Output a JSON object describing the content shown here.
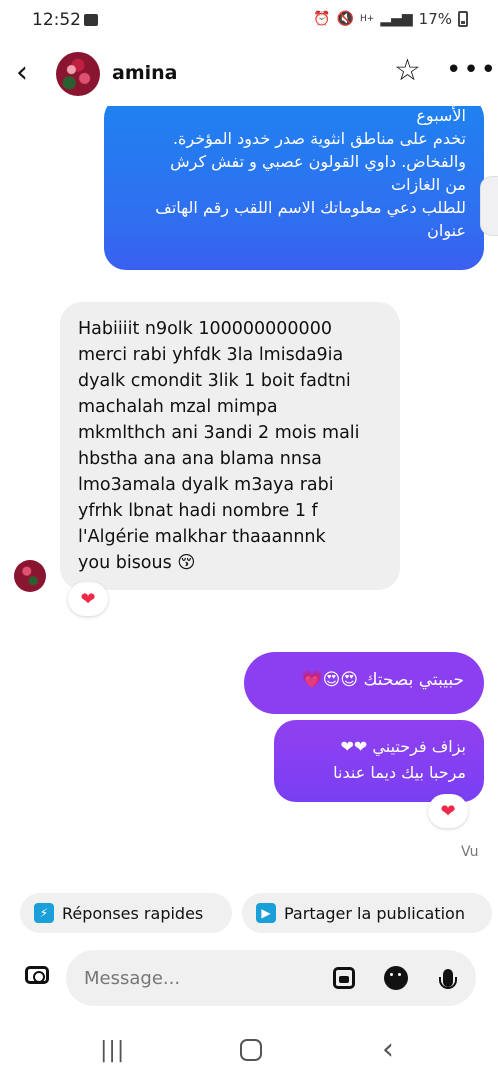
{
  "status_bar": {
    "time": "12:52",
    "icons": [
      "gallery-icon",
      "alarm-icon",
      "mute-icon",
      "network-icon",
      "signal-icon"
    ],
    "battery": "17%"
  },
  "header": {
    "contact_name": "amina",
    "icons": [
      "back-icon",
      "avatar",
      "star-icon",
      "more-icon"
    ]
  },
  "messages": {
    "sent_blue": {
      "lines": [
        "الأسبوع",
        "تخدم على مناطق انثوية صدر خدود  المؤخرة.",
        "والفخاض. داوي القولون عصبي و تفش كرش",
        "من الغازات",
        "للطلب دعي معلوماتك الاسم اللقب رقم  الهاتف",
        "عنوان"
      ]
    },
    "received": {
      "lines": [
        "Habiiiit n9olk 100000000000",
        "merci rabi yhfdk 3la lmisda9ia",
        "dyalk cmondit 3lik 1 boit fadtni",
        "machalah mzal mimpa",
        "mkmlthch ani 3andi 2 mois mali",
        "hbstha ana ana blama nnsa",
        "lmo3amala dyalk m3aya rabi",
        "yfrhk lbnat hadi nombre 1 f",
        "l'Algérie malkhar thaaannnk",
        "you bisous 😚"
      ],
      "reaction": "❤"
    },
    "sent_purple_1": "حبيبتي بصحتك 😍😍💗",
    "sent_purple_2": {
      "lines": [
        "بزاف فرحتيني ❤❤",
        "مرحبا بيك ديما عندنا"
      ],
      "reaction": "❤"
    },
    "seen": "Vu"
  },
  "quick_actions": {
    "quick_replies": "Réponses rapides",
    "share_post": "Partager la publication"
  },
  "composer": {
    "placeholder": "Message..."
  },
  "nav": {
    "recents": "|||",
    "back": "‹"
  }
}
